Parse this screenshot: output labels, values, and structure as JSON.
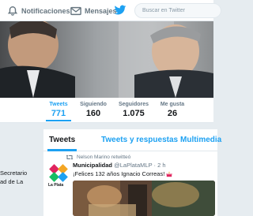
{
  "nav": {
    "notifications": "Notificaciones",
    "messages": "Mensajes",
    "search_placeholder": "Buscar en Twitter"
  },
  "stats": [
    {
      "label": "Tweets",
      "value": "771"
    },
    {
      "label": "Siguiendo",
      "value": "160"
    },
    {
      "label": "Seguidores",
      "value": "1.075"
    },
    {
      "label": "Me gusta",
      "value": "26"
    }
  ],
  "profile": {
    "bio_line1": "Secretario",
    "bio_line2": "ad de La"
  },
  "tabs": {
    "tweets": "Tweets",
    "replies": "Tweets y respuestas",
    "media": "Multimedia"
  },
  "tweet": {
    "retweet_note": "Nelson Marino retwitteó",
    "author_name": "Municipalidad",
    "author_handle": "@LaPlataMLP",
    "time": "· 2 h",
    "text": "¡Felices 132 años Ignacio Correas!",
    "logo_caption": "La Plata"
  },
  "colors": {
    "accent": "#1da1f2",
    "text": "#14171a",
    "muted": "#657786"
  }
}
